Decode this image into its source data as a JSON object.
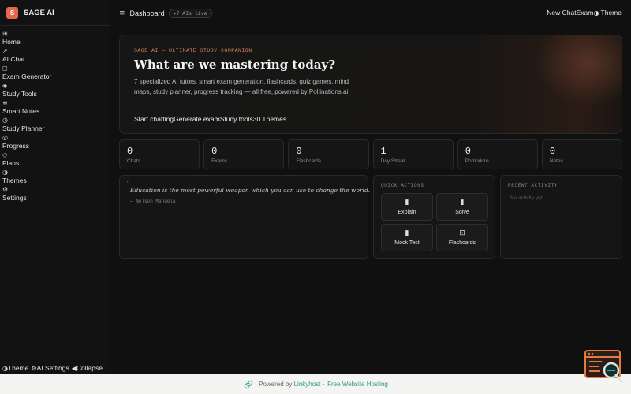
{
  "brand": {
    "logo_letter": "S",
    "name": "SAGE AI"
  },
  "sidebar": {
    "items": [
      {
        "icon": "⊞",
        "label": "Home"
      },
      {
        "icon": "↗",
        "label": "AI Chat"
      },
      {
        "icon": "◻",
        "label": "Exam Generator"
      },
      {
        "icon": "◈",
        "label": "Study Tools"
      },
      {
        "icon": "≡",
        "label": "Smart Notes"
      },
      {
        "icon": "◷",
        "label": "Study Planner"
      },
      {
        "icon": "◎",
        "label": "Progress"
      },
      {
        "icon": "◇",
        "label": "Plans"
      },
      {
        "icon": "◑",
        "label": "Themes"
      },
      {
        "icon": "⚙",
        "label": "Settings"
      }
    ],
    "footer": {
      "theme_icon": "◑",
      "theme_label": "Theme",
      "settings_icon": "⚙",
      "settings_label": "AI Settings",
      "collapse_icon": "◀",
      "collapse_label": "Collapse"
    }
  },
  "topbar": {
    "menu_icon": "≡",
    "title": "Dashboard",
    "badge": "✦7 AIs live",
    "new_chat": "New Chat",
    "exam": "Exam",
    "theme_icon": "◑",
    "theme": "Theme"
  },
  "hero": {
    "eyebrow": "SAGE AI — ULTIMATE STUDY COMPANION",
    "title": "What are we mastering today?",
    "description": "7 specialized AI tutors, smart exam generation, flashcards, quiz games, mind maps, study planner, progress tracking — all free, powered by Pollinations.ai.",
    "actions": [
      "Start chatting",
      "Generate exam",
      "Study tools",
      "30 Themes"
    ]
  },
  "stats": [
    {
      "value": "0",
      "label": "Chats"
    },
    {
      "value": "0",
      "label": "Exams"
    },
    {
      "value": "0",
      "label": "Flashcards"
    },
    {
      "value": "1",
      "label": "Day Streak"
    },
    {
      "value": "0",
      "label": "Pomodoro"
    },
    {
      "value": "0",
      "label": "Notes"
    }
  ],
  "quote": {
    "mark": "“",
    "text": "Education is the most powerful weapon which you can use to change the world.",
    "author": "— Nelson Mandela"
  },
  "quick_actions": {
    "title": "QUICK ACTIONS",
    "items": [
      {
        "icon": "▮",
        "label": "Explain"
      },
      {
        "icon": "▮",
        "label": "Solve"
      },
      {
        "icon": "▮",
        "label": "Mock Test"
      },
      {
        "icon": "⊡",
        "label": "Flashcards"
      }
    ]
  },
  "recent_activity": {
    "title": "RECENT ACTIVITY",
    "empty": "No activity yet"
  },
  "footer": {
    "prefix": "Powered by",
    "brand": "Linkyhost",
    "separator": "·",
    "tagline": "Free Website Hosting"
  },
  "colors": {
    "accent": "#e06a4a",
    "background": "#101010",
    "card": "#151515",
    "link": "#2f9a8a"
  }
}
